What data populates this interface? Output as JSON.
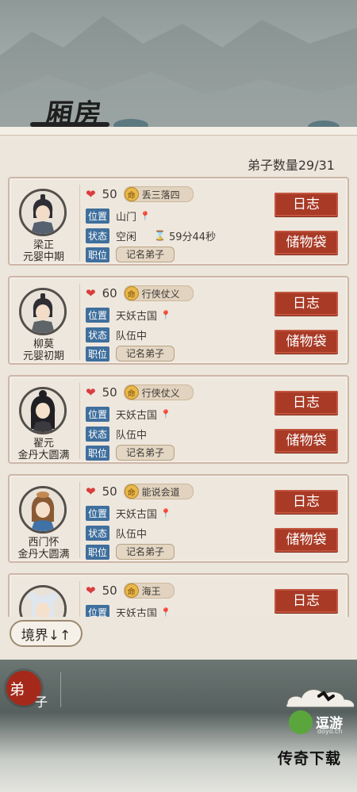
{
  "header": {
    "title": "厢房"
  },
  "count_label": "弟子数量29/31",
  "labels": {
    "position": "位置",
    "status": "状态",
    "rank": "职位",
    "log": "日志",
    "bag": "储物袋"
  },
  "disciples": [
    {
      "name": "梁正",
      "realm": "元婴中期",
      "hp": "50",
      "fate": "丢三落四",
      "location": "山门",
      "status": "空闲",
      "timer": "59分44秒",
      "rank": "记名弟子"
    },
    {
      "name": "柳莫",
      "realm": "元婴初期",
      "hp": "60",
      "fate": "行侠仗义",
      "location": "天妖古国",
      "status": "队伍中",
      "rank": "记名弟子"
    },
    {
      "name": "翟元",
      "realm": "金丹大圆满",
      "hp": "50",
      "fate": "行侠仗义",
      "location": "天妖古国",
      "status": "队伍中",
      "rank": "记名弟子"
    },
    {
      "name": "西门怀",
      "realm": "金丹大圆满",
      "hp": "50",
      "fate": "能说会道",
      "location": "天妖古国",
      "status": "队伍中",
      "rank": "记名弟子"
    },
    {
      "name": "",
      "realm": "",
      "hp": "50",
      "fate": "海王",
      "location": "天妖古国",
      "status": "",
      "rank": ""
    }
  ],
  "fate_icon": "命",
  "sort_button": "境界↓↑",
  "nav": {
    "tab_disciple_1": "弟",
    "tab_disciple_2": "子"
  },
  "logo": {
    "text": "逗游",
    "sub": "doyo.cn"
  },
  "watermark": "传奇下载",
  "colors": {
    "accent_red": "#a83a26",
    "tag_blue": "#3f6f9d",
    "heart": "#d93d3d"
  }
}
